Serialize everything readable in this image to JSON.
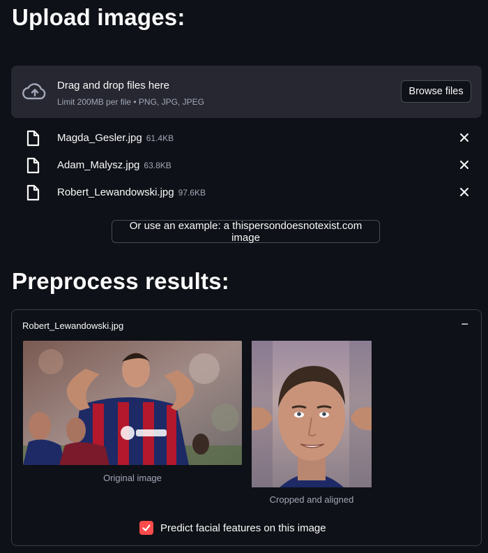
{
  "headers": {
    "upload": "Upload images:",
    "preprocess": "Preprocess results:"
  },
  "dropzone": {
    "title": "Drag and drop files here",
    "limit": "Limit 200MB per file • PNG, JPG, JPEG",
    "browse_label": "Browse files",
    "icon": "cloud-upload-icon"
  },
  "files": [
    {
      "name": "Magda_Gesler.jpg",
      "size": "61.4KB"
    },
    {
      "name": "Adam_Malysz.jpg",
      "size": "63.8KB"
    },
    {
      "name": "Robert_Lewandowski.jpg",
      "size": "97.6KB"
    }
  ],
  "example_button": "Or use an example: a thispersondoesnotexist.com image",
  "expander": {
    "title": "Robert_Lewandowski.jpg",
    "collapse_symbol": "−",
    "original_caption": "Original image",
    "cropped_caption": "Cropped and aligned",
    "checkbox_label": "Predict facial features on this image",
    "checkbox_checked": true
  },
  "colors": {
    "background": "#0e1117",
    "panel": "#262730",
    "accent": "#ff4b4b",
    "muted_text": "#a3a8b8"
  }
}
